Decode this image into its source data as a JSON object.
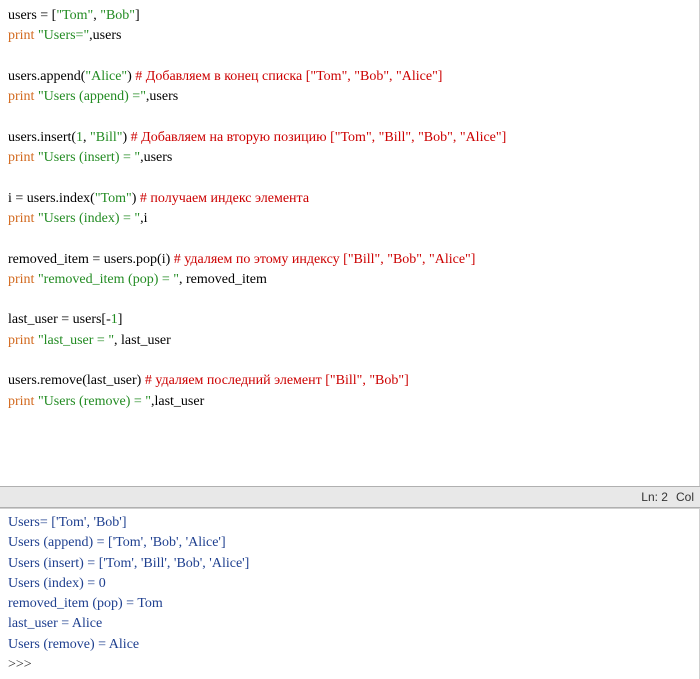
{
  "editor": {
    "lines": [
      [
        {
          "cls": "t-black",
          "text": "users = ["
        },
        {
          "cls": "t-green",
          "text": "\"Tom\""
        },
        {
          "cls": "t-black",
          "text": ", "
        },
        {
          "cls": "t-green",
          "text": "\"Bob\""
        },
        {
          "cls": "t-black",
          "text": "]"
        }
      ],
      [
        {
          "cls": "t-orange",
          "text": "print"
        },
        {
          "cls": "t-black",
          "text": " "
        },
        {
          "cls": "t-green",
          "text": "\"Users=\""
        },
        {
          "cls": "t-black",
          "text": ",users"
        }
      ],
      [],
      [
        {
          "cls": "t-black",
          "text": "users.append("
        },
        {
          "cls": "t-green",
          "text": "\"Alice\""
        },
        {
          "cls": "t-black",
          "text": ")  "
        },
        {
          "cls": "t-red",
          "text": "# Добавляем в конец списка [\"Tom\", \"Bob\", \"Alice\"]"
        }
      ],
      [
        {
          "cls": "t-orange",
          "text": "print"
        },
        {
          "cls": "t-black",
          "text": " "
        },
        {
          "cls": "t-green",
          "text": "\"Users (append) =\""
        },
        {
          "cls": "t-black",
          "text": ",users"
        }
      ],
      [],
      [
        {
          "cls": "t-black",
          "text": "users.insert("
        },
        {
          "cls": "t-green",
          "text": "1"
        },
        {
          "cls": "t-black",
          "text": ", "
        },
        {
          "cls": "t-green",
          "text": "\"Bill\""
        },
        {
          "cls": "t-black",
          "text": ")    "
        },
        {
          "cls": "t-red",
          "text": "# Добавляем на вторую позицию [\"Tom\", \"Bill\", \"Bob\", \"Alice\"]"
        }
      ],
      [
        {
          "cls": "t-orange",
          "text": "print"
        },
        {
          "cls": "t-black",
          "text": " "
        },
        {
          "cls": "t-green",
          "text": "\"Users (insert) = \""
        },
        {
          "cls": "t-black",
          "text": ",users"
        }
      ],
      [],
      [
        {
          "cls": "t-black",
          "text": "i = users.index("
        },
        {
          "cls": "t-green",
          "text": "\"Tom\""
        },
        {
          "cls": "t-black",
          "text": ")         "
        },
        {
          "cls": "t-red",
          "text": "# получаем индекс элемента"
        }
      ],
      [
        {
          "cls": "t-orange",
          "text": "print"
        },
        {
          "cls": "t-black",
          "text": " "
        },
        {
          "cls": "t-green",
          "text": "\"Users (index) = \""
        },
        {
          "cls": "t-black",
          "text": ",i"
        }
      ],
      [],
      [
        {
          "cls": "t-black",
          "text": "removed_item = users.pop(i)     "
        },
        {
          "cls": "t-red",
          "text": "# удаляем по этому индексу [\"Bill\", \"Bob\", \"Alice\"]"
        }
      ],
      [
        {
          "cls": "t-orange",
          "text": "print"
        },
        {
          "cls": "t-black",
          "text": " "
        },
        {
          "cls": "t-green",
          "text": "\"removed_item (pop) = \""
        },
        {
          "cls": "t-black",
          "text": ", removed_item"
        }
      ],
      [],
      [
        {
          "cls": "t-black",
          "text": "last_user = users[-"
        },
        {
          "cls": "t-green",
          "text": "1"
        },
        {
          "cls": "t-black",
          "text": "]"
        }
      ],
      [
        {
          "cls": "t-orange",
          "text": "print"
        },
        {
          "cls": "t-black",
          "text": " "
        },
        {
          "cls": "t-green",
          "text": "\"last_user = \""
        },
        {
          "cls": "t-black",
          "text": ", last_user"
        }
      ],
      [],
      [
        {
          "cls": "t-black",
          "text": "users.remove(last_user)            "
        },
        {
          "cls": "t-red",
          "text": "# удаляем последний элемент [\"Bill\", \"Bob\"]"
        }
      ],
      [
        {
          "cls": "t-orange",
          "text": "print"
        },
        {
          "cls": "t-black",
          "text": " "
        },
        {
          "cls": "t-green",
          "text": "\"Users (remove) = \""
        },
        {
          "cls": "t-black",
          "text": ",last_user"
        }
      ]
    ]
  },
  "status": {
    "ln": "Ln: 2",
    "col": "Col"
  },
  "shell": {
    "lines": [
      "Users= ['Tom', 'Bob']",
      "Users (append) = ['Tom', 'Bob', 'Alice']",
      "Users (insert) =  ['Tom', 'Bill', 'Bob', 'Alice']",
      "Users (index) =  0",
      "removed_item (pop) =  Tom",
      "last_user =  Alice",
      "Users (remove) =  Alice"
    ],
    "prompt": ">>> "
  }
}
